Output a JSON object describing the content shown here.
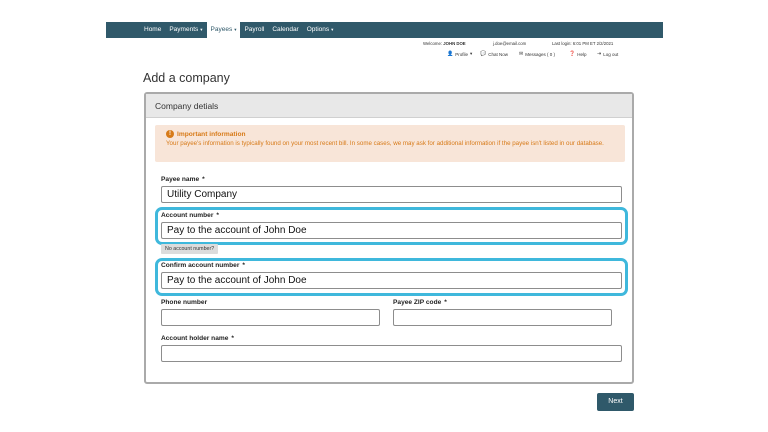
{
  "nav": {
    "items": [
      {
        "label": "Home",
        "caret": ""
      },
      {
        "label": "Payments",
        "caret": "▾"
      },
      {
        "label": "Payees",
        "caret": "▾"
      },
      {
        "label": "Payroll",
        "caret": ""
      },
      {
        "label": "Calendar",
        "caret": ""
      },
      {
        "label": "Options",
        "caret": "▾"
      }
    ],
    "active": "Payees"
  },
  "user": {
    "welcome_prefix": "Welcome:",
    "name": "JOHN DOE",
    "email": "j.doe@email.com",
    "last_login": "Last login: 6:01 PM ET  2/2/2021"
  },
  "utility": {
    "profile": "Profile",
    "chat": "Chat Now",
    "messages": "Messages ( 0 )",
    "help": "Help",
    "logout": "Log out"
  },
  "page_title": "Add a company",
  "panel": {
    "title": "Company detials"
  },
  "alert": {
    "title": "Important information",
    "body": "Your payee's information is typically found on your most recent bill. In some cases, we may ask for additional information if the payee isn't listed in our database."
  },
  "form": {
    "payee_name": {
      "label": "Payee name",
      "required": "*",
      "value": "Utility Company"
    },
    "account_number": {
      "label": "Account number",
      "required": "*",
      "value": "Pay to the account of John Doe"
    },
    "no_account_link": "No account number?",
    "confirm_account": {
      "label": "Confirm account number",
      "required": "*",
      "value": "Pay to the account of John Doe"
    },
    "phone": {
      "label": "Phone number",
      "value": ""
    },
    "zip": {
      "label": "Payee ZIP code",
      "required": "*",
      "value": ""
    },
    "holder": {
      "label": "Account holder name",
      "required": "*",
      "value": ""
    }
  },
  "next_button": "Next",
  "colors": {
    "nav_bg": "#30596a",
    "highlight": "#3fb8dc",
    "alert_bg": "#f8e5d8",
    "alert_text": "#d77a18",
    "button_bg": "#2f596a"
  }
}
